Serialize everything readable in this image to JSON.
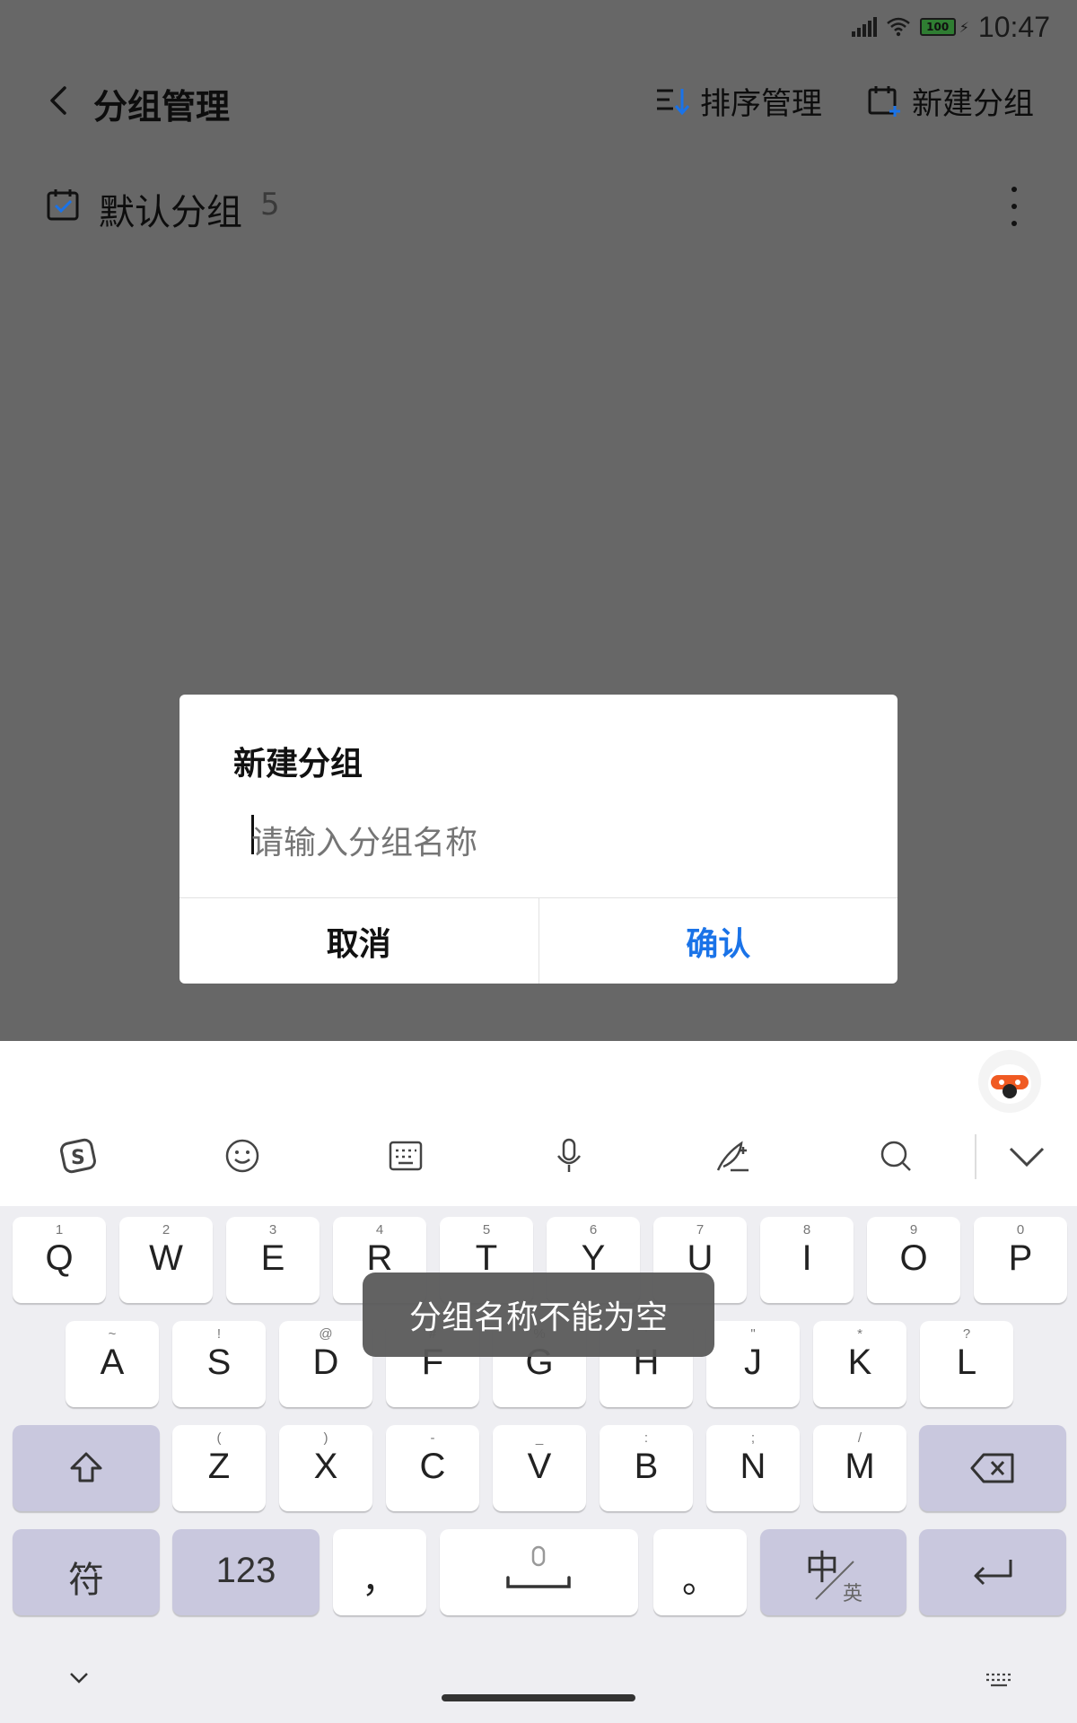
{
  "status_bar": {
    "time": "10:47",
    "battery": "100"
  },
  "header": {
    "title": "分组管理",
    "sort_label": "排序管理",
    "new_group_label": "新建分组"
  },
  "groups": [
    {
      "name": "默认分组",
      "count": "5"
    }
  ],
  "dialog": {
    "title": "新建分组",
    "input_placeholder": "请输入分组名称",
    "input_value": "",
    "cancel_label": "取消",
    "confirm_label": "确认",
    "confirm_color": "#1a73e8"
  },
  "toast": "分组名称不能为空",
  "keyboard": {
    "toolbar_icons": [
      "sogou-logo-icon",
      "emoji-icon",
      "keyboard-layout-icon",
      "microphone-icon",
      "handwriting-icon",
      "search-icon",
      "collapse-icon"
    ],
    "row1": [
      {
        "main": "Q",
        "sub": "1"
      },
      {
        "main": "W",
        "sub": "2"
      },
      {
        "main": "E",
        "sub": "3"
      },
      {
        "main": "R",
        "sub": "4"
      },
      {
        "main": "T",
        "sub": "5"
      },
      {
        "main": "Y",
        "sub": "6"
      },
      {
        "main": "U",
        "sub": "7"
      },
      {
        "main": "I",
        "sub": "8"
      },
      {
        "main": "O",
        "sub": "9"
      },
      {
        "main": "P",
        "sub": "0"
      }
    ],
    "row2": [
      {
        "main": "A",
        "sub": "~"
      },
      {
        "main": "S",
        "sub": "!"
      },
      {
        "main": "D",
        "sub": "@"
      },
      {
        "main": "F",
        "sub": "#"
      },
      {
        "main": "G",
        "sub": "%"
      },
      {
        "main": "H",
        "sub": "'"
      },
      {
        "main": "J",
        "sub": "\""
      },
      {
        "main": "K",
        "sub": "*"
      },
      {
        "main": "L",
        "sub": "?"
      }
    ],
    "row3": [
      {
        "main": "Z",
        "sub": "("
      },
      {
        "main": "X",
        "sub": ")"
      },
      {
        "main": "C",
        "sub": "-"
      },
      {
        "main": "V",
        "sub": "_"
      },
      {
        "main": "B",
        "sub": ":"
      },
      {
        "main": "N",
        "sub": ";"
      },
      {
        "main": "M",
        "sub": "/"
      }
    ],
    "symbols_label": "符",
    "numbers_label": "123",
    "comma_label": "，",
    "period_label": "。",
    "lang_main": "中",
    "lang_sub": "英"
  }
}
